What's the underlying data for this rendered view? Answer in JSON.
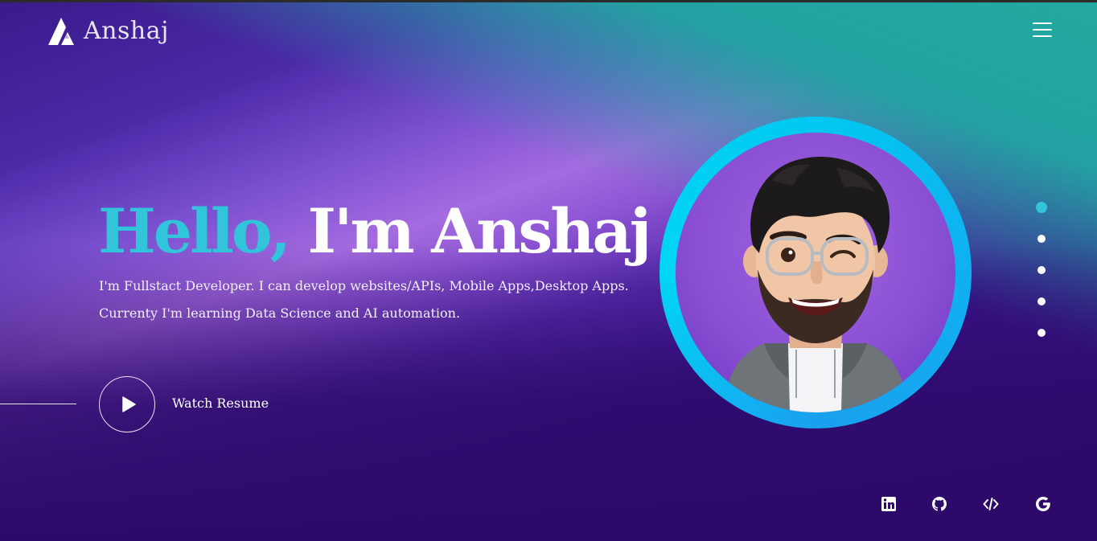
{
  "brand": {
    "name": "Anshaj",
    "logo_icon": "brand-a-logo-icon"
  },
  "header": {
    "menu_icon": "hamburger-menu-icon"
  },
  "hero": {
    "greeting": "Hello,",
    "name_line": "I'm Anshaj",
    "line1": "I'm Fullstact Developer. I can develop websites/APIs, Mobile Apps,Desktop Apps.",
    "line2": "Currenty I'm learning Data Science and AI automation.",
    "cta_label": "Watch Resume",
    "cta_icon": "play-icon"
  },
  "avatar": {
    "icon": "memoji-avatar-winking"
  },
  "slider": {
    "dots_count": 5,
    "active_index": 0
  },
  "social": [
    {
      "name": "linkedin",
      "icon": "linkedin-icon"
    },
    {
      "name": "github",
      "icon": "github-icon"
    },
    {
      "name": "code",
      "icon": "code-icon"
    },
    {
      "name": "google",
      "icon": "google-icon"
    }
  ],
  "colors": {
    "accent": "#31c4da",
    "ring": "#00c8f0",
    "background_dark": "#2c0b6b",
    "background_light": "#a56be0",
    "teal": "#22a9a0"
  }
}
